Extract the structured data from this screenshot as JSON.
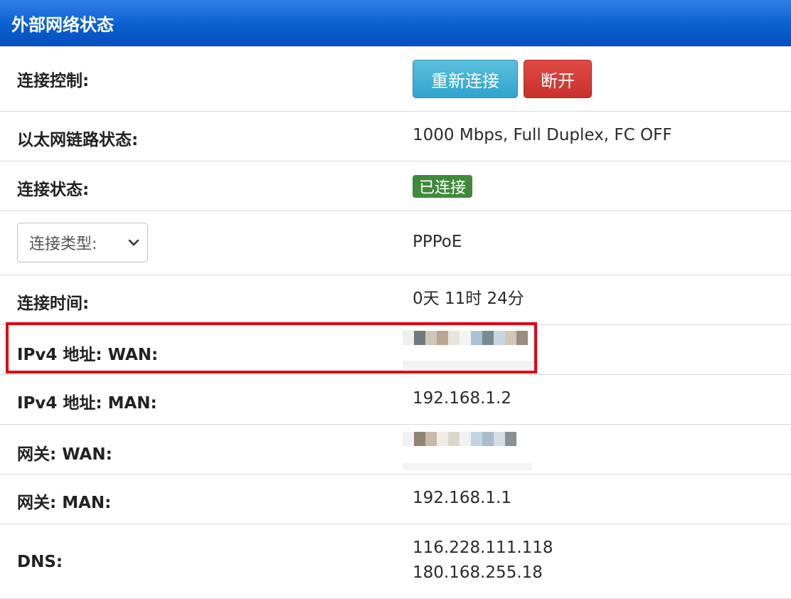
{
  "header": {
    "title": "外部网络状态"
  },
  "rows": {
    "connection_control": {
      "label": "连接控制:",
      "reconnect_label": "重新连接",
      "disconnect_label": "断开"
    },
    "ethernet_link": {
      "label": "以太网链路状态:",
      "value": "1000 Mbps, Full Duplex, FC OFF"
    },
    "connection_status": {
      "label": "连接状态:",
      "badge": "已连接"
    },
    "connection_type": {
      "select_value": "连接类型:",
      "value": "PPPoE"
    },
    "connection_time": {
      "label": "连接时间:",
      "value": "0天 11时 24分"
    },
    "ipv4_wan": {
      "label": "IPv4 地址: WAN:"
    },
    "ipv4_man": {
      "label": "IPv4 地址: MAN:",
      "value": "192.168.1.2"
    },
    "gateway_wan": {
      "label": "网关: WAN:"
    },
    "gateway_man": {
      "label": "网关: MAN:",
      "value": "192.168.1.1"
    },
    "dns": {
      "label": "DNS:",
      "values": [
        "116.228.111.118",
        "180.168.255.18"
      ]
    }
  },
  "colors": {
    "header_blue": "#0b5fd0",
    "reconnect_button": "#31a3cd",
    "disconnect_button": "#c9302c",
    "connected_badge": "#3f8a3a",
    "highlight_box": "#e00012"
  }
}
